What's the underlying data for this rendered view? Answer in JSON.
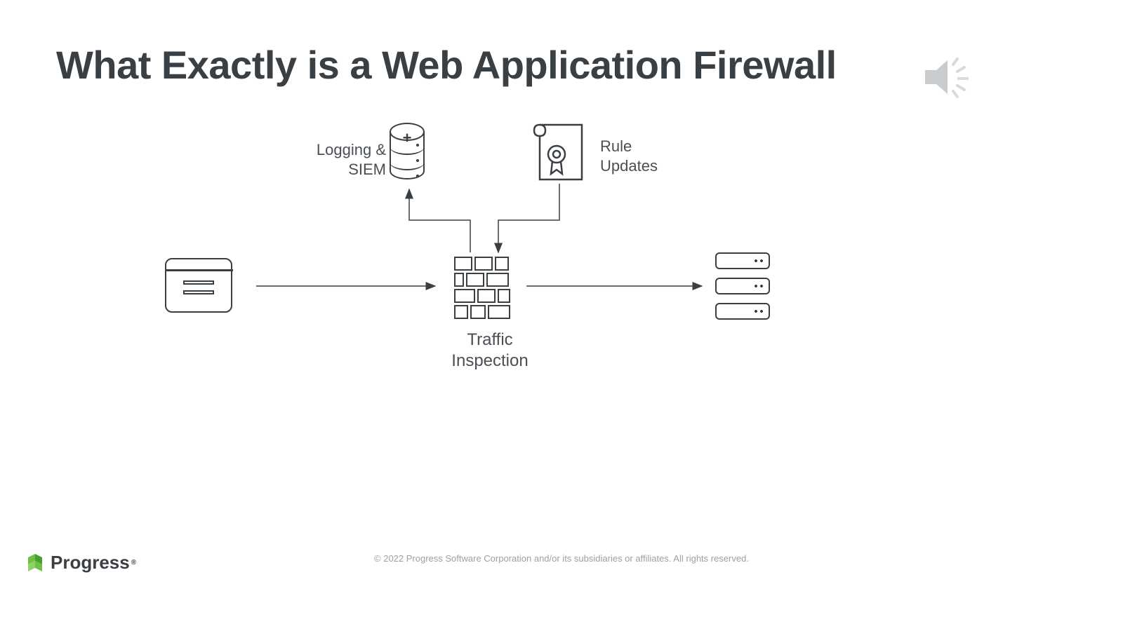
{
  "title": "What Exactly is a Web Application Firewall",
  "labels": {
    "logging": "Logging & SIEM",
    "rules": "Rule Updates",
    "traffic": "Traffic Inspection"
  },
  "footer": {
    "copyright": "© 2022 Progress Software Corporation and/or its subsidiaries or affiliates. All rights reserved.",
    "brand": "Progress"
  },
  "icons": {
    "browser": "browser-window",
    "firewall": "brick-firewall",
    "servers": "server-stack",
    "database": "database-cylinder",
    "certificate": "certificate-scroll",
    "speaker": "audio-speaker"
  },
  "colors": {
    "text": "#3a3f44",
    "muted": "#9aa0a6",
    "accent": "#6fbf44"
  }
}
